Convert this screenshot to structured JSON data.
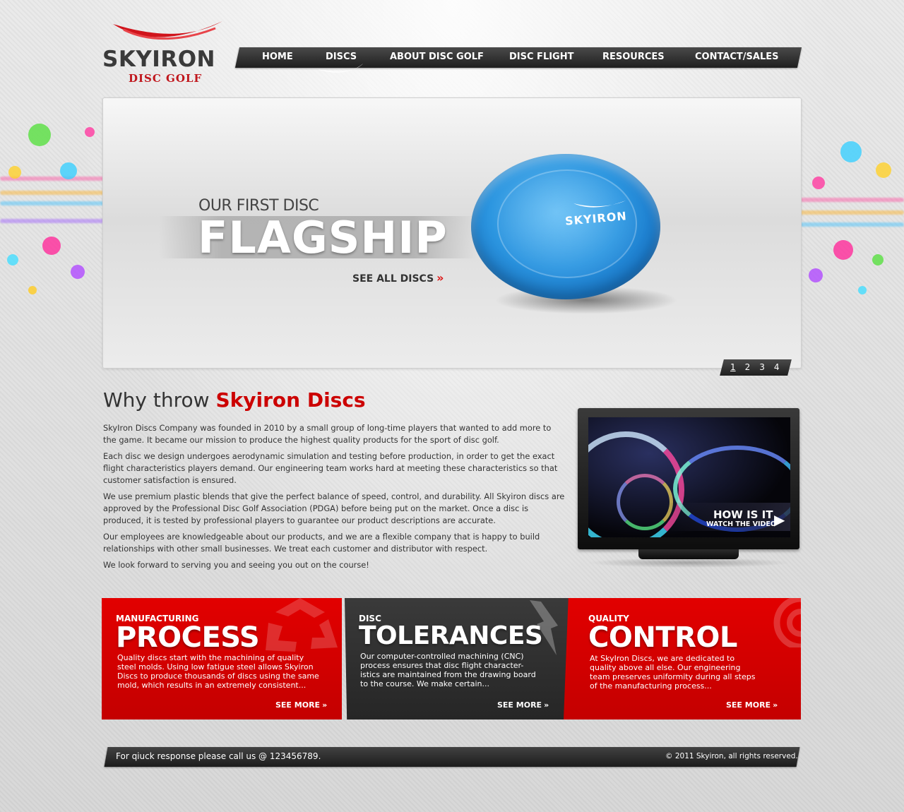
{
  "brand": {
    "name": "SKYIRON",
    "sub": "DISC GOLF"
  },
  "nav": {
    "items": [
      {
        "label": "HOME"
      },
      {
        "label": "DISCS"
      },
      {
        "label": "ABOUT DISC GOLF"
      },
      {
        "label": "DISC FLIGHT"
      },
      {
        "label": "RESOURCES"
      },
      {
        "label": "CONTACT/SALES"
      }
    ],
    "active": "DISCS"
  },
  "hero": {
    "kicker": "OUR FIRST DISC",
    "title": "FLAGSHIP",
    "cta": "SEE ALL DISCS",
    "disc_logo": "SKYIRON",
    "pages": [
      "1",
      "2",
      "3",
      "4"
    ],
    "active_page": "1"
  },
  "why": {
    "title_prefix": "Why throw",
    "title_brand": "Skyiron Discs",
    "paragraphs": [
      "SkyIron Discs Company was founded in 2010 by a small group of long-time players that wanted to add more to the game. It became our mission to produce the highest quality products for the sport of disc golf.",
      "Each disc we design undergoes aerodynamic simulation and testing before production, in order to get the exact flight characteristics players demand. Our engineering team works hard at meeting these characteristics so that customer satisfaction is ensured.",
      "We use premium plastic blends that give the perfect balance of speed, control, and durability. All Skyiron discs are approved by the Professional Disc Golf Association (PDGA) before being put on the market. Once a disc is produced, it is tested by professional players to guarantee our product descriptions are accurate.",
      "Our employees are knowledgeable about our products, and we are a flexible company that is happy to build relationships with other small businesses. We treat each customer and distributor with respect.",
      "We look forward to serving you and seeing you out on the course!"
    ]
  },
  "video": {
    "title": "HOW IS IT",
    "subtitle": "WATCH THE VIDEO"
  },
  "boxes": [
    {
      "kicker": "MANUFACTURING",
      "title": "PROCESS",
      "text": "Quality discs start with the machining of quality steel molds. Using low fatigue steel allows Skyiron Discs to produce thousands of discs using the same mold, which results in an extremely consistent...",
      "more": "SEE MORE"
    },
    {
      "kicker": "DISC",
      "title": "TOLERANCES",
      "text": "Our computer-controlled machining (CNC) process ensures that disc flight character-istics are maintained from the drawing board to the course. We make certain...",
      "more": "SEE MORE"
    },
    {
      "kicker": "QUALITY",
      "title": "CONTROL",
      "text": "At SkyIron Discs, we are dedicated to quality above all else. Our engineering team preserves uniformity during all steps of the manufacturing process...",
      "more": "SEE MORE"
    }
  ],
  "footer": {
    "contact": "For qiuck response please call us @ 123456789.",
    "copyright": "© 2011 Skyiron, all rights reserved."
  },
  "colors": {
    "brand_red": "#cc0000",
    "dark": "#2c2c2c",
    "disc_blue": "#2c96e0"
  },
  "icons": [
    "swoosh-icon",
    "double-chevron-right-icon",
    "play-icon",
    "recycle-icon",
    "lightning-icon",
    "target-icon"
  ]
}
